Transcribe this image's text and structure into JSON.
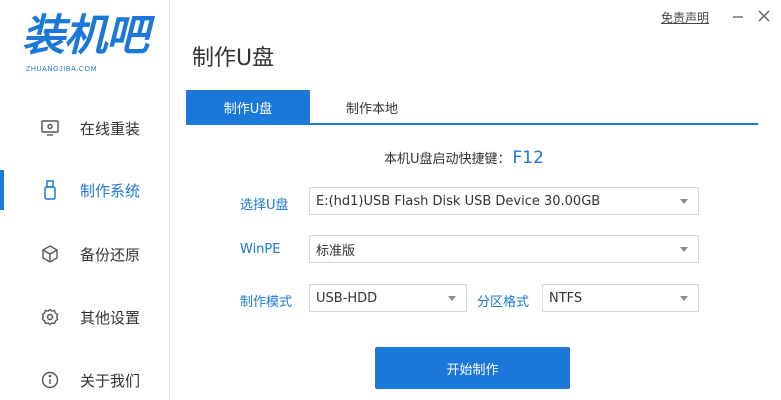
{
  "brand": {
    "logo_text": "装机吧",
    "logo_sub": "ZHUANGJIBA.COM"
  },
  "sidebar": {
    "items": [
      {
        "label": "在线重装",
        "icon": "monitor-icon"
      },
      {
        "label": "制作系统",
        "icon": "usb-drive-icon"
      },
      {
        "label": "备份还原",
        "icon": "backup-cube-icon"
      },
      {
        "label": "其他设置",
        "icon": "gear-icon"
      },
      {
        "label": "关于我们",
        "icon": "info-icon"
      }
    ],
    "active_index": 1
  },
  "topbar": {
    "disclaimer": "免责声明"
  },
  "page": {
    "title": "制作U盘"
  },
  "tabs": [
    {
      "label": "制作U盘",
      "active": true
    },
    {
      "label": "制作本地",
      "active": false
    }
  ],
  "shortcut": {
    "text": "本机U盘启动快捷键：",
    "key": "F12"
  },
  "form": {
    "usb_label": "选择U盘",
    "usb_value": "E:(hd1)USB Flash Disk USB Device 30.00GB",
    "winpe_label": "WinPE",
    "winpe_value": "标准版",
    "mode_label": "制作模式",
    "mode_value": "USB-HDD",
    "partition_label": "分区格式",
    "partition_value": "NTFS"
  },
  "actions": {
    "start_label": "开始制作"
  },
  "colors": {
    "accent": "#1b78d8",
    "border": "#d9d9d9",
    "text": "#333333"
  }
}
